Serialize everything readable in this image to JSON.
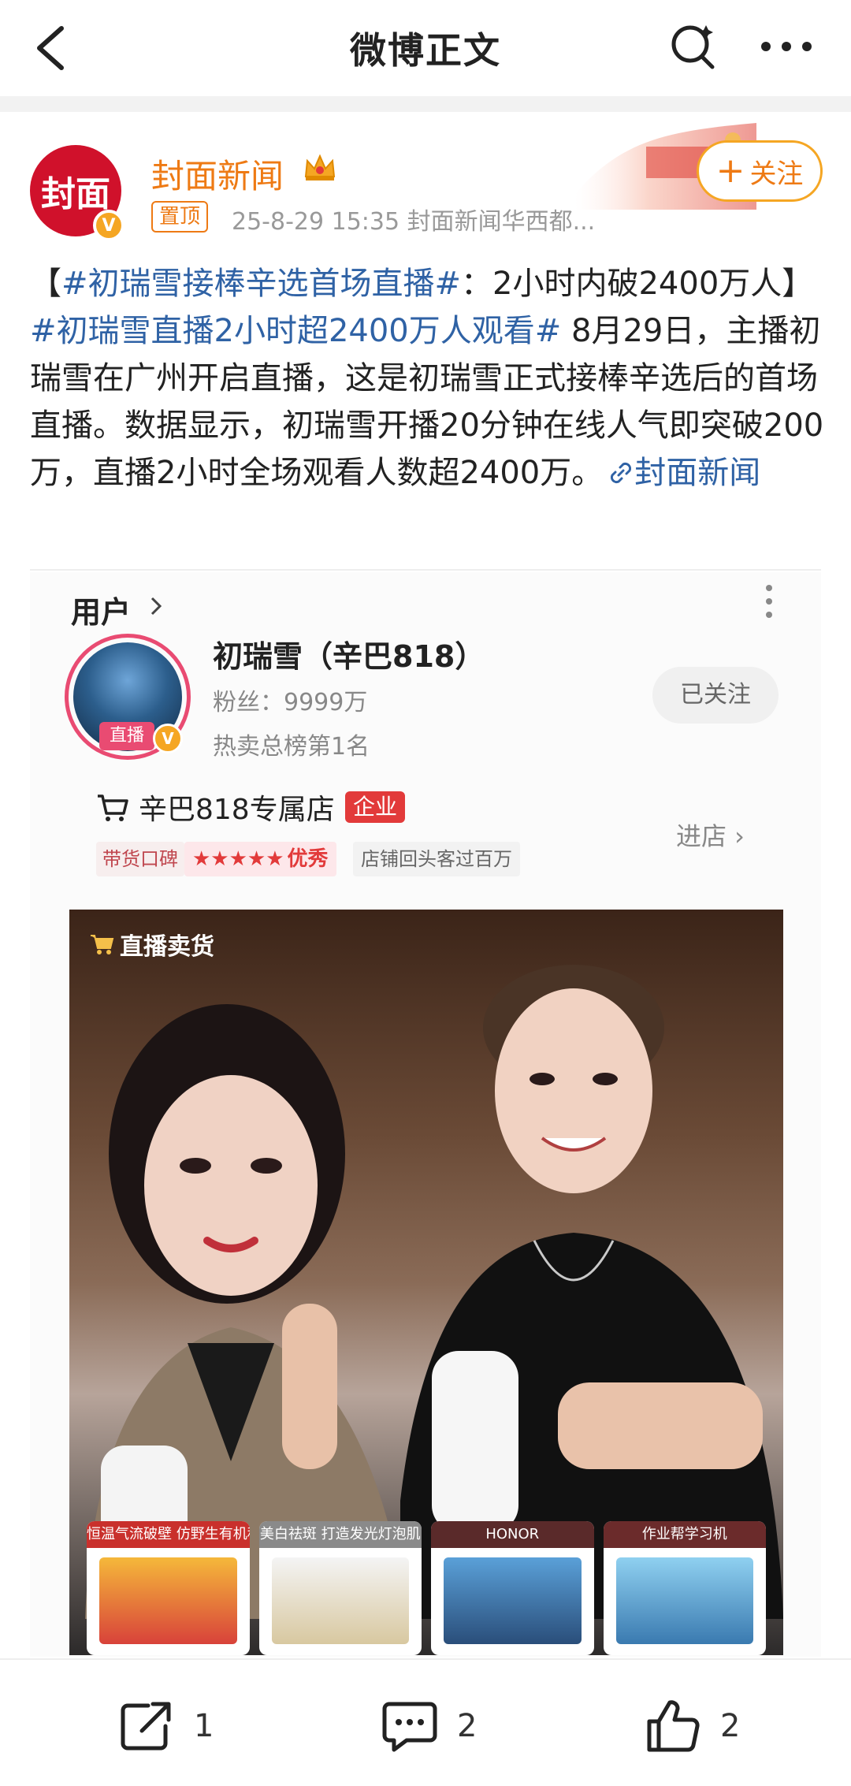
{
  "topbar": {
    "title": "微博正文"
  },
  "author": {
    "avatar_text": "封面",
    "avatar_badge": "V",
    "name": "封面新闻",
    "pin_label": "置顶",
    "meta": "25-8-29 15:35  封面新闻华西都...",
    "follow_label": "关注"
  },
  "post": {
    "bracket_open": "【",
    "hashtag1": "#初瑞雪接棒辛选首场直播#",
    "text1": "：2小时内破2400万人】",
    "hashtag2": "#初瑞雪直播2小时超2400万人观看#",
    "text2": " 8月29日，主播初瑞雪在广州开启直播，这是初瑞雪正式接棒辛选后的首场直播。数据显示，初瑞雪开播20分钟在线人气即突破200万，直播2小时全场观看人数超2400万。",
    "link_text": "封面新闻"
  },
  "embed": {
    "users_label": "用户",
    "user": {
      "name": "初瑞雪（辛巴818）",
      "fans": "粉丝：9999万",
      "rank": "热卖总榜第1名",
      "live_tag": "直播",
      "badge": "V",
      "followed_label": "已关注"
    },
    "store": {
      "name": "辛巴818专属店",
      "ent_badge": "企业",
      "enter_label": "进店 ›",
      "rating_label": "带货口碑",
      "rating_stars": "★★★★★",
      "rating_word": "优秀",
      "rating_value": 4.5,
      "repeat_tag": "店铺回头客过百万"
    },
    "video": {
      "live_label": "直播卖货",
      "products": [
        {
          "title": "恒温气流破壁 仿野生有机种植",
          "color": "#c9302c"
        },
        {
          "title": "美白祛斑 打造发光灯泡肌",
          "color": "#8a8a8a"
        },
        {
          "title": "HONOR",
          "color": "#5a2a2a"
        },
        {
          "title": "作业帮学习机",
          "color": "#6b2b2b"
        }
      ]
    }
  },
  "actions": {
    "share_count": "1",
    "comment_count": "2",
    "like_count": "2"
  }
}
